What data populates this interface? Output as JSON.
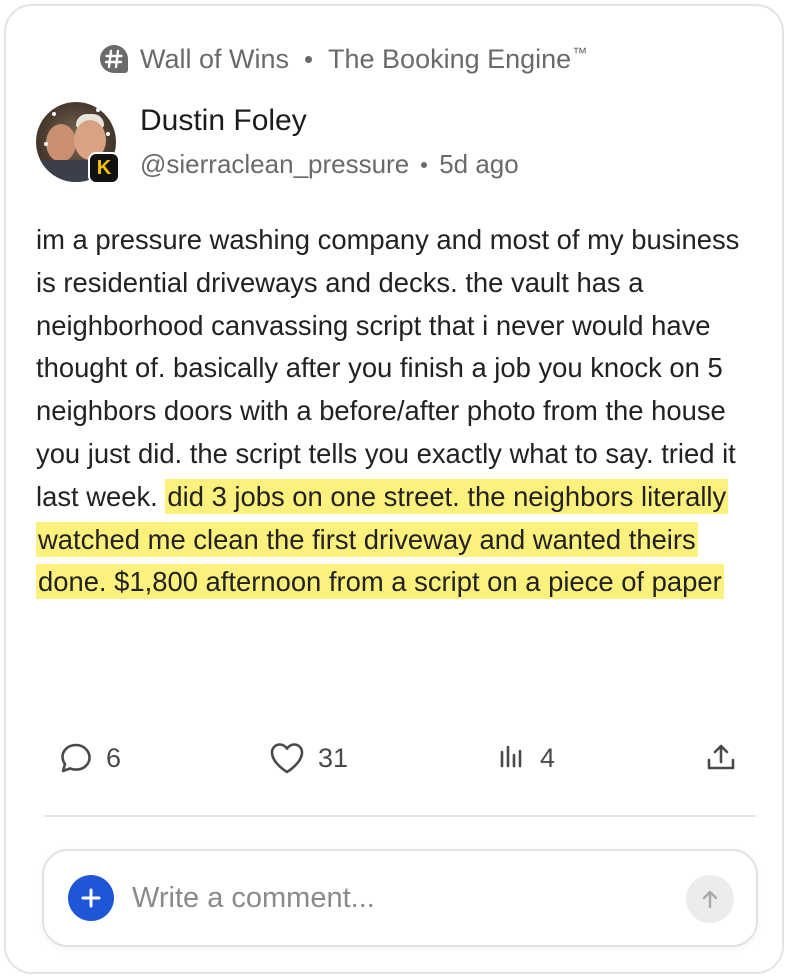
{
  "community": {
    "space_name": "Wall of Wins",
    "group_name": "The Booking Engine",
    "trademark": "™",
    "icon": "hashtag-chat-icon"
  },
  "author": {
    "name": "Dustin Foley",
    "handle": "@sierraclean_pressure",
    "time_ago": "5d ago",
    "badge_letter": "K"
  },
  "post": {
    "text_plain": "im a pressure washing company and most of my business is residential driveways and decks. the vault has a neighborhood canvassing script that i never would have thought of. basically after you finish a job you knock on 5 neighbors doors with a before/after photo from the house you just did. the script tells you exactly what to say. tried it last week. ",
    "text_highlighted": "did 3 jobs on one street. the neighbors literally watched me clean the first driveway and wanted theirs done. $1,800 afternoon from a script on a piece of paper",
    "highlight_color": "#fdf17e"
  },
  "actions": {
    "comments": {
      "count": "6",
      "icon": "comment-icon"
    },
    "likes": {
      "count": "31",
      "icon": "heart-icon"
    },
    "views": {
      "count": "4",
      "icon": "bar-chart-icon"
    },
    "share": {
      "icon": "share-icon"
    }
  },
  "composer": {
    "placeholder": "Write a comment...",
    "add_icon": "plus-icon",
    "send_icon": "arrow-up-icon",
    "accent_color": "#1f56d8"
  }
}
